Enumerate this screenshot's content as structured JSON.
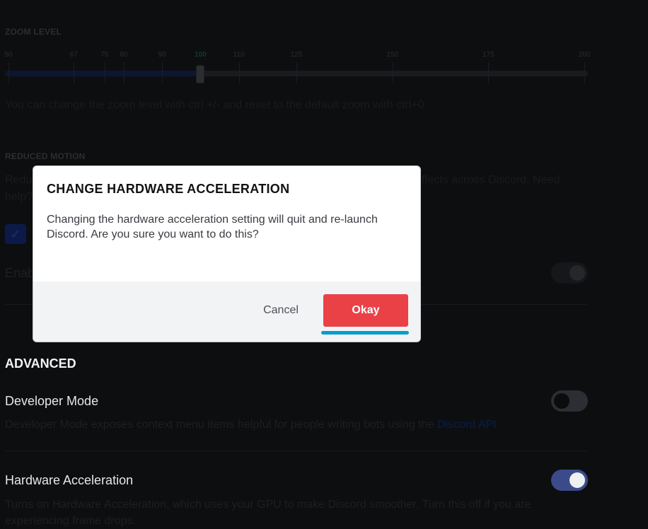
{
  "appearance": {
    "zoom_label": "ZOOM LEVEL",
    "zoom_value": 100,
    "zoom_ticks": [
      "50",
      "67",
      "75",
      "80",
      "90",
      "100",
      "110",
      "125",
      "150",
      "175",
      "200"
    ],
    "zoom_help": "You can change the zoom level with ctrl +/- and reset to the default zoom with ctrl+0."
  },
  "reduced_motion": {
    "label": "REDUCED MOTION",
    "desc_left_1": "Redu",
    "desc_right_1": "ffects across Discord. Need",
    "desc_left_2": "help?",
    "checkbox_checked": true,
    "checkbox_glyph": "✓",
    "enable_label_partial": "Enab",
    "toggle_on": true
  },
  "advanced": {
    "heading": "ADVANCED",
    "developer_mode": {
      "title": "Developer Mode",
      "desc": "Developer Mode exposes context menu items helpful for people writing bots using the ",
      "link_text": "Discord API",
      "desc_end": ".",
      "enabled": false
    },
    "hardware_acceleration": {
      "title": "Hardware Acceleration",
      "desc_line1": "Turns on Hardware Acceleration, which uses your GPU to make Discord smoother. Turn this off if you are",
      "desc_line2": "experiencing frame drops.",
      "enabled": true
    }
  },
  "modal": {
    "title": "CHANGE HARDWARE ACCELERATION",
    "body": "Changing the hardware acceleration setting will quit and re-launch Discord. Are you sure you want to do this?",
    "cancel_label": "Cancel",
    "okay_label": "Okay"
  },
  "colors": {
    "danger": "#ea4147",
    "focus": "#009ecb",
    "toggle_on": "#3b4b8a"
  }
}
